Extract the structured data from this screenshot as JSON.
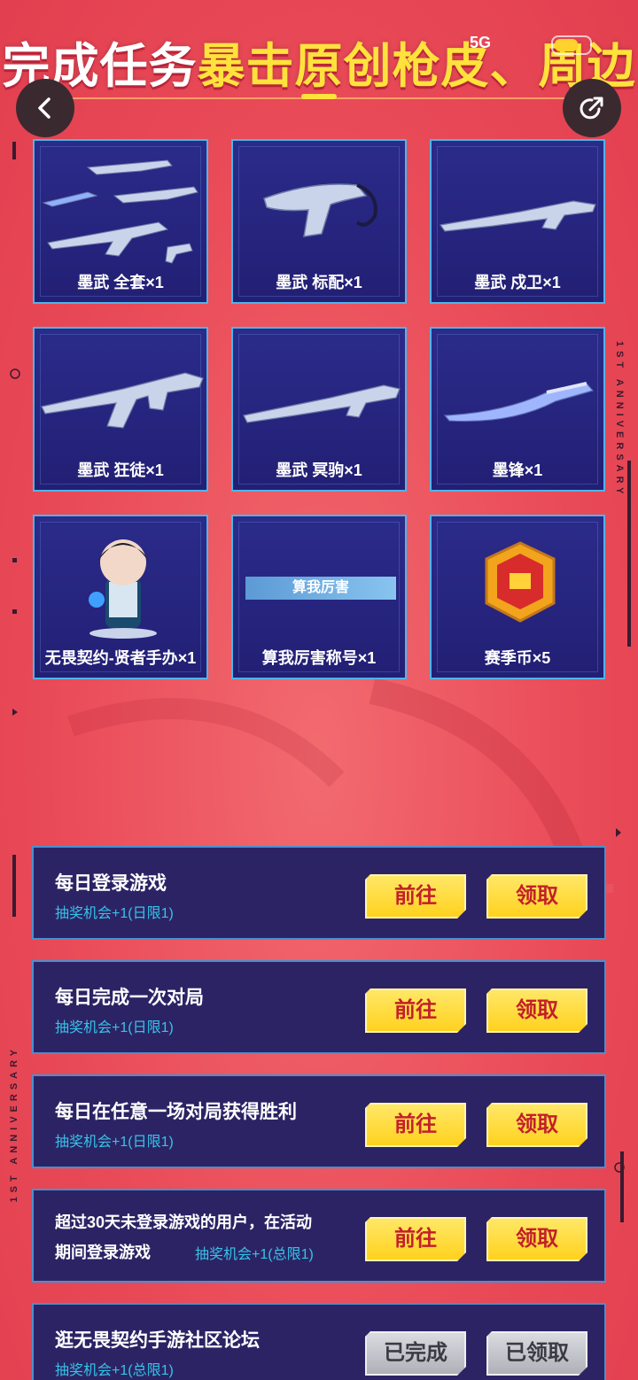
{
  "header": {
    "title_part1": "完成任务",
    "title_part2": "暴击原创枪皮、周边",
    "status_network": "5G"
  },
  "rewards": [
    {
      "label": "墨武 全套×1",
      "art": "weapon-set"
    },
    {
      "label": "墨武 标配×1",
      "art": "pistol"
    },
    {
      "label": "墨武 戍卫×1",
      "art": "sniper"
    },
    {
      "label": "墨武 狂徒×1",
      "art": "rifle"
    },
    {
      "label": "墨武 冥驹×1",
      "art": "sniper"
    },
    {
      "label": "墨锋×1",
      "art": "knife"
    },
    {
      "label": "无畏契约-贤者手办×1",
      "art": "figure"
    },
    {
      "label": "算我厉害称号×1",
      "art": "title",
      "banner": "算我厉害"
    },
    {
      "label": "赛季币×5",
      "art": "coin"
    }
  ],
  "tasks": [
    {
      "name": "每日登录游戏",
      "sub": "抽奖机会+1(日限1)",
      "go": "前往",
      "claim": "领取"
    },
    {
      "name": "每日完成一次对局",
      "sub": "抽奖机会+1(日限1)",
      "go": "前往",
      "claim": "领取"
    },
    {
      "name": "每日在任意一场对局获得胜利",
      "sub": "抽奖机会+1(日限1)",
      "go": "前往",
      "claim": "领取"
    },
    {
      "name": "超过30天未登录游戏的用户，在活动",
      "name2": "期间登录游戏",
      "sub": "抽奖机会+1(总限1)",
      "go": "前往",
      "claim": "领取"
    },
    {
      "name": "逛无畏契约手游社区论坛",
      "sub": "抽奖机会+1(总限1)",
      "go": "已完成",
      "claim": "已领取"
    }
  ],
  "side_text": "1ST ANNIVERSARY",
  "colors": {
    "bg": "#e94a57",
    "card": "#2b2b8a",
    "accent": "#ffd21e",
    "sub": "#35c4e8"
  }
}
